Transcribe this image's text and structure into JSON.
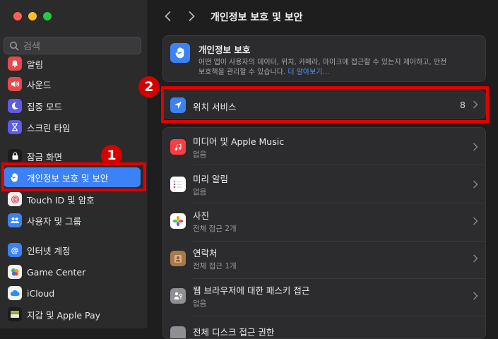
{
  "window": {
    "title": "개인정보 보호 및 보안"
  },
  "search": {
    "placeholder": "검색"
  },
  "sidebar": {
    "items": [
      {
        "label": "알림",
        "icon": "bell-icon",
        "color": "#e5484d"
      },
      {
        "label": "사운드",
        "icon": "speaker-icon",
        "color": "#e5484d"
      },
      {
        "label": "집중 모드",
        "icon": "moon-icon",
        "color": "#5e5ce6"
      },
      {
        "label": "스크린 타임",
        "icon": "hourglass-icon",
        "color": "#5e5ce6"
      },
      {
        "label": "잠금 화면",
        "icon": "lock-icon",
        "color": "#1c1c1e"
      },
      {
        "label": "개인정보 보호 및 보안",
        "icon": "hand-icon",
        "color": "#3b82f6"
      },
      {
        "label": "Touch ID 및 암호",
        "icon": "fingerprint-icon",
        "color": "#f2f2f2"
      },
      {
        "label": "사용자 및 그룹",
        "icon": "users-icon",
        "color": "#3b82f6"
      },
      {
        "label": "인터넷 계정",
        "icon": "at-icon",
        "color": "#3b82f6"
      },
      {
        "label": "Game Center",
        "icon": "game-center-icon",
        "color": "#f2f2f2"
      },
      {
        "label": "iCloud",
        "icon": "cloud-icon",
        "color": "#f2f2f2"
      },
      {
        "label": "지갑 및 Apple Pay",
        "icon": "wallet-icon",
        "color": "#1c1c1e"
      }
    ]
  },
  "privacy_header": {
    "title": "개인정보 보호",
    "desc_line1": "어떤 앱이 사용자의 데이터, 위치, 카메라, 마이크에 접근할 수 있는지 제어하고, 안전",
    "desc_line2": "보호책을 관리할 수 있습니다.",
    "link": "더 알아보기..."
  },
  "location": {
    "label": "위치 서비스",
    "count": "8"
  },
  "rows": [
    {
      "title": "미디어 및 Apple Music",
      "sub": "없음",
      "icon": "music-icon",
      "color": "#fc3c44"
    },
    {
      "title": "미리 알림",
      "sub": "없음",
      "icon": "reminders-icon",
      "color": "#ffffff"
    },
    {
      "title": "사진",
      "sub": "전체 접근 2개",
      "icon": "photos-icon",
      "color": "#ffffff"
    },
    {
      "title": "연락처",
      "sub": "전체 접근 1개",
      "icon": "contacts-icon",
      "color": "#a87a4a"
    },
    {
      "title": "웹 브라우저에 대한 패스키 접근",
      "sub": "없음",
      "icon": "passkey-icon",
      "color": "#8e8e93"
    },
    {
      "title": "전체 디스크 접근 권한",
      "sub": "",
      "icon": "disk-icon",
      "color": "#8e8e93"
    }
  ],
  "annotations": {
    "badge1": "1",
    "badge2": "2"
  }
}
